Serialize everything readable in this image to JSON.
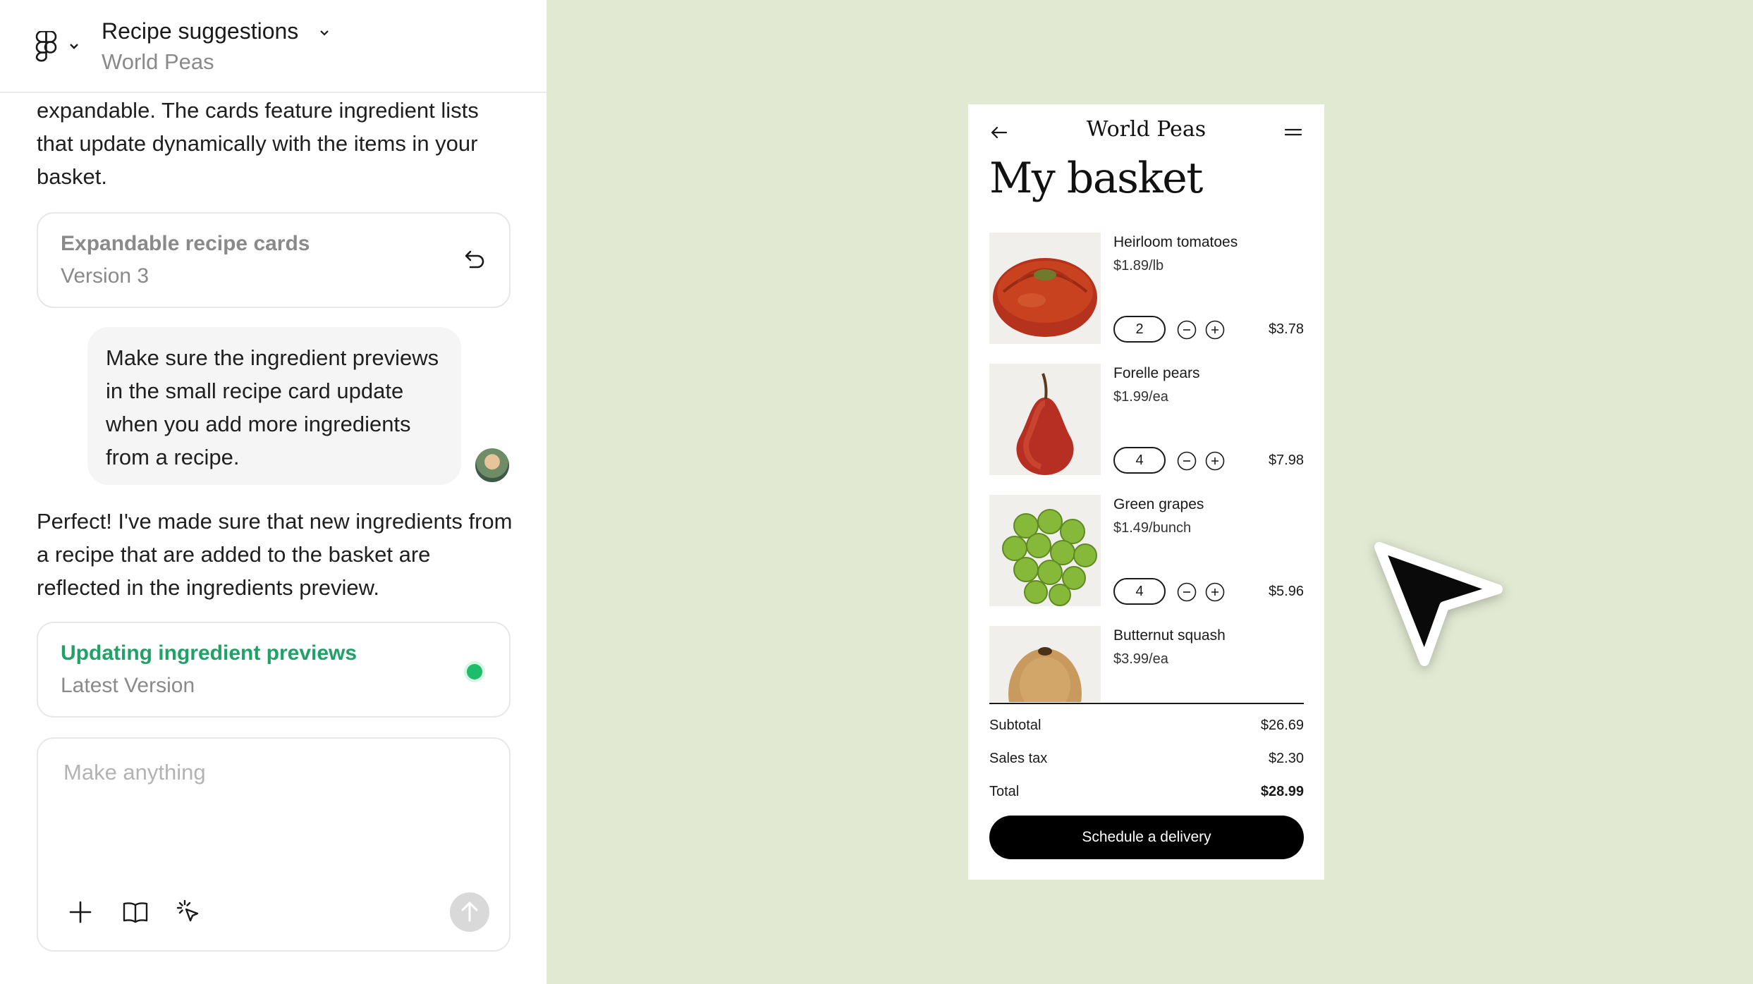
{
  "topbar": {
    "title": "Recipe suggestions",
    "subtitle": "World Peas",
    "logo_icon": "figma-logo-icon"
  },
  "chat": {
    "intro_text": "expandable. The cards feature ingredient lists that update dynamically with the items in your basket.",
    "version_card_1": {
      "title": "Expandable recipe cards",
      "subtitle": "Version 3",
      "icon": "restore-icon"
    },
    "user_message": "Make sure the ingredient previews in the small recipe card update when you add more ingredients from a recipe.",
    "assistant_message": "Perfect! I've made sure that new ingredients from a recipe that are added to the basket are reflected in the ingredients preview.",
    "version_card_2": {
      "title": "Updating ingredient previews",
      "subtitle": "Latest Version",
      "status_color": "#1ebd6b"
    },
    "composer": {
      "placeholder": "Make anything",
      "icons": [
        "plus-icon",
        "book-icon",
        "sparkle-cursor-icon",
        "send-arrow-icon"
      ]
    }
  },
  "phone": {
    "brand": "World Peas",
    "heading": "My basket",
    "items": [
      {
        "name": "Heirloom tomatoes",
        "price": "$1.89/lb",
        "qty": "2",
        "total": "$3.78"
      },
      {
        "name": "Forelle pears",
        "price": "$1.99/ea",
        "qty": "4",
        "total": "$7.98"
      },
      {
        "name": "Green grapes",
        "price": "$1.49/bunch",
        "qty": "4",
        "total": "$5.96"
      },
      {
        "name": "Butternut squash",
        "price": "$3.99/ea"
      }
    ],
    "summary": {
      "subtotal_label": "Subtotal",
      "subtotal": "$26.69",
      "tax_label": "Sales tax",
      "tax": "$2.30",
      "total_label": "Total",
      "total": "$28.99"
    },
    "cta": "Schedule a delivery"
  },
  "colors": {
    "canvas_bg": "#e1e9d3",
    "accent_green": "#1ea266",
    "cta_bg": "#000000"
  }
}
